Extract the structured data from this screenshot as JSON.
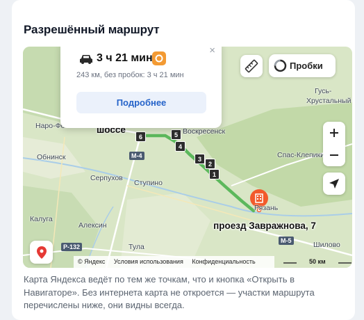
{
  "section": {
    "title": "Разрешённый маршрут"
  },
  "popup": {
    "duration": "3 ч 21 мин",
    "distance_text": "243 км, без пробок: 3 ч 21 мин",
    "details_button": "Подробнее",
    "close_symbol": "×"
  },
  "map": {
    "traffic_button": "Пробки",
    "places": {
      "naro_fominsk": "Наро-Фо",
      "obninsk": "Обнинск",
      "serpukhov": "Серпухов",
      "stupino": "Ступино",
      "aleksin": "Алексин",
      "kaluga": "Калуга",
      "tula": "Тула",
      "voskresensk": "Воскресенск",
      "gus_khrustalny_1": "Гусь-",
      "gus_khrustalny_2": "Хрустальный",
      "spas_klepiki": "Спас-Клепики",
      "shilovo": "Шилово",
      "ryazan": "Рязань"
    },
    "highway_label": "шоссе",
    "road_badges": [
      "M-4",
      "P-132",
      "M-5"
    ],
    "route_markers": [
      "6",
      "5",
      "4",
      "3",
      "2",
      "1"
    ],
    "destination_label": "проезд Завражнова, 7",
    "footer": {
      "copyright": "© Яндекс",
      "terms": "Условия использования",
      "privacy": "Конфиденциальность"
    },
    "scale_label": "50 км",
    "colors": {
      "route": "#5cb85c",
      "destination_pin": "#f25a2b",
      "traffic_icon": "#f39a33",
      "location_pin": "#e53935"
    },
    "icons": [
      "car-icon",
      "traffic-jam-icon",
      "ruler-icon",
      "traffic-light-icon",
      "zoom-in-icon",
      "zoom-out-icon",
      "locate-arrow-icon",
      "location-pin-icon",
      "building-icon"
    ]
  },
  "description": "Карта Яндекса ведёт по тем же точкам, что и кнопка «Открыть в Навигаторе». Без интернета карта не откроется — участки маршрута перечислены ниже, они видны всегда."
}
